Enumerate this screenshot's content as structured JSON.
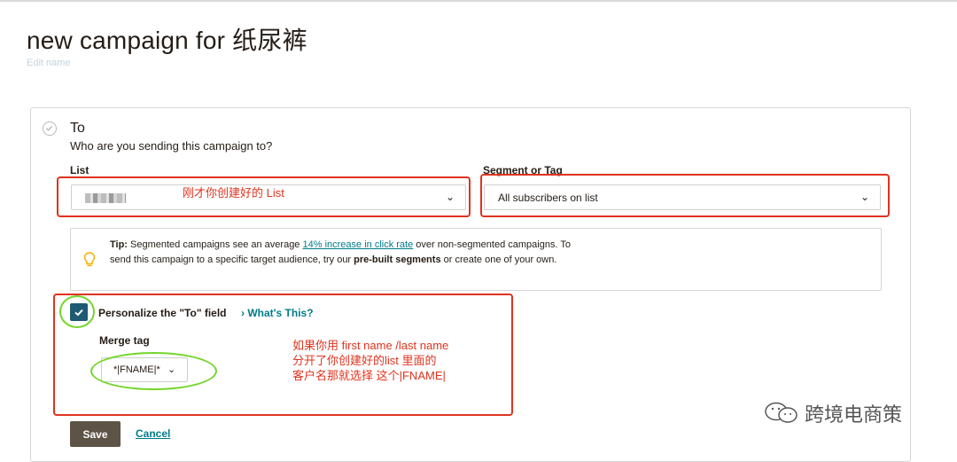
{
  "page": {
    "title": "new campaign for 纸尿裤",
    "edit_name": "Edit name"
  },
  "to_section": {
    "heading": "To",
    "subheading": "Who are you sending this campaign to?"
  },
  "list": {
    "label": "List",
    "annotation": "刚才你创建好的 List"
  },
  "segment": {
    "label": "Segment or Tag",
    "value": "All subscribers on list"
  },
  "tip": {
    "bold": "Tip:",
    "text1": " Segmented campaigns see an average ",
    "link": "14% increase in click rate",
    "text2": " over non-segmented campaigns. To send this campaign to a specific target audience, try our ",
    "bold2": "pre-built segments",
    "text3": " or create one of your own."
  },
  "personalize": {
    "label": "Personalize the \"To\" field",
    "whats_this": "What's This?",
    "checked": true
  },
  "merge_tag": {
    "label": "Merge tag",
    "value": "*|FNAME|*",
    "annotation_line1": "如果你用 first name /last name",
    "annotation_line2": "分开了你创建好的list 里面的",
    "annotation_line3": "客户名那就选择 这个|FNAME|"
  },
  "actions": {
    "save": "Save",
    "cancel": "Cancel"
  },
  "watermark": "跨境电商策",
  "colors": {
    "annotation_red": "#e0331f",
    "highlight_green": "#74d62c",
    "link_teal": "#007c89",
    "checkbox_fill": "#1e5a72"
  },
  "icons": {
    "check_circle": "check-circle-icon",
    "tip": "lightbulb-icon",
    "chevron": "chevron-down-icon",
    "whats_this": "chevron-right-icon",
    "watermark": "wechat-icon"
  }
}
